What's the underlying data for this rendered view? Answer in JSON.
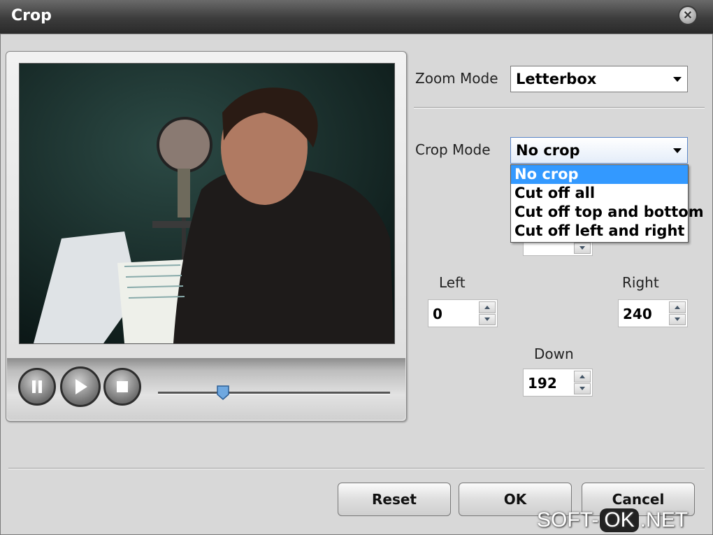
{
  "window": {
    "title": "Crop"
  },
  "zoom": {
    "label": "Zoom Mode",
    "value": "Letterbox"
  },
  "crop": {
    "label": "Crop Mode",
    "value": "No crop",
    "options": [
      "No crop",
      "Cut off all",
      "Cut off top and bottom",
      "Cut off left and right"
    ]
  },
  "fields": {
    "left": {
      "label": "Left",
      "value": "0"
    },
    "right": {
      "label": "Right",
      "value": "240"
    },
    "down": {
      "label": "Down",
      "value": "192"
    }
  },
  "player": {
    "seek_fraction": 0.28
  },
  "buttons": {
    "reset": "Reset",
    "ok": "OK",
    "cancel": "Cancel"
  },
  "watermark": {
    "part1": "SOFT-",
    "part2": "OK",
    "part3": ".NET"
  }
}
